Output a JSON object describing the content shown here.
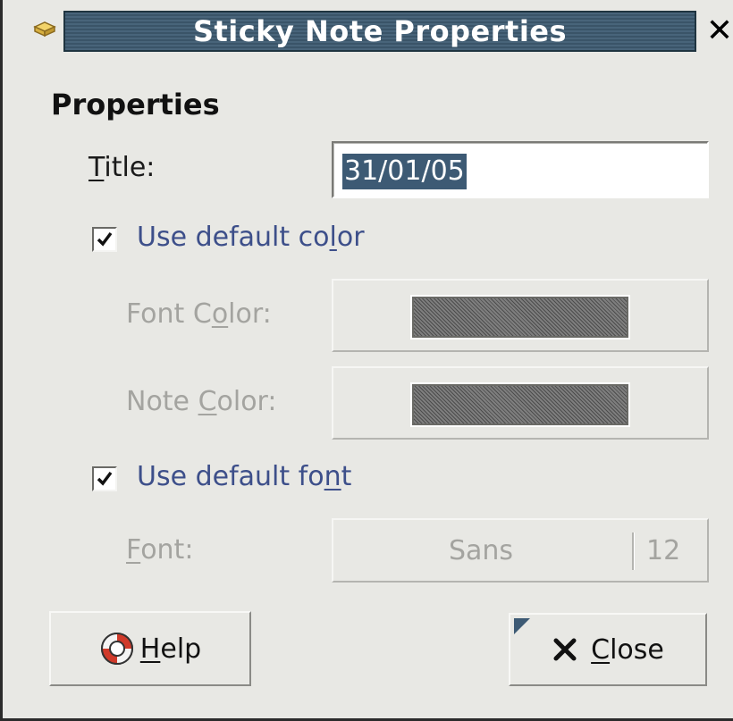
{
  "window": {
    "title": "Sticky Note Properties",
    "close_glyph": "✕",
    "icon": "sticky-note-icon"
  },
  "section": {
    "title": "Properties"
  },
  "title_field": {
    "label_mnemonic": "T",
    "label_rest": "itle:",
    "value": "31/01/05"
  },
  "default_color": {
    "checked": true,
    "label_pre": "Use default co",
    "label_mnemonic": "l",
    "label_post": "or"
  },
  "font_color": {
    "label_pre": "Font C",
    "label_mnemonic": "o",
    "label_post": "lor:"
  },
  "note_color": {
    "label_pre": "Note ",
    "label_mnemonic": "C",
    "label_post": "olor:"
  },
  "default_font": {
    "checked": true,
    "label_pre": "Use default fo",
    "label_mnemonic": "n",
    "label_post": "t"
  },
  "font": {
    "label_mnemonic": "F",
    "label_post": "ont:",
    "name": "Sans",
    "size": "12"
  },
  "buttons": {
    "help_mnemonic": "H",
    "help_rest": "elp",
    "close_mnemonic": "C",
    "close_rest": "lose"
  },
  "colors": {
    "titlebar": "#48647a",
    "selection": "#3d5a74",
    "check_label": "#3d4f8a",
    "disabled_text": "#a4a4a0"
  }
}
